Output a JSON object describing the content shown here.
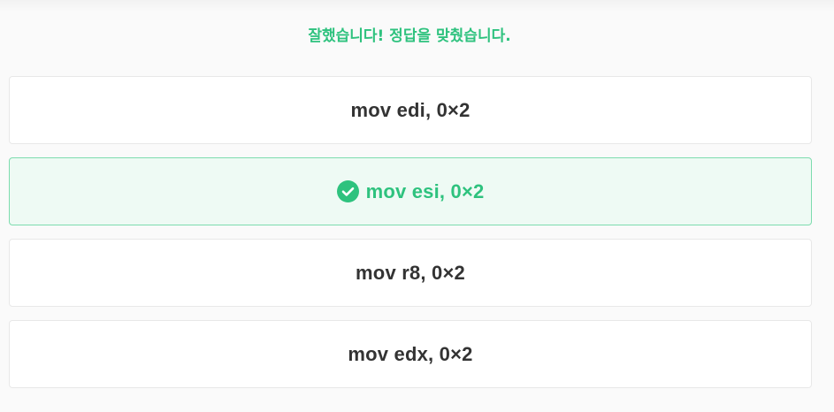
{
  "feedback": {
    "message": "잘했습니다! 정답을 맞췄습니다."
  },
  "options": [
    {
      "label": "mov edi, 0×2",
      "state": "default"
    },
    {
      "label": "mov esi, 0×2",
      "state": "correct",
      "icon": "check-circle-icon"
    },
    {
      "label": "mov r8, 0×2",
      "state": "default"
    },
    {
      "label": "mov edx, 0×2",
      "state": "default"
    }
  ],
  "colors": {
    "accent_green": "#2ec27e",
    "correct_bg": "#eefaf4",
    "correct_border": "#7ddcae",
    "text_dark": "#333333",
    "card_border": "#e8e8e8",
    "page_bg": "#fafafa"
  }
}
